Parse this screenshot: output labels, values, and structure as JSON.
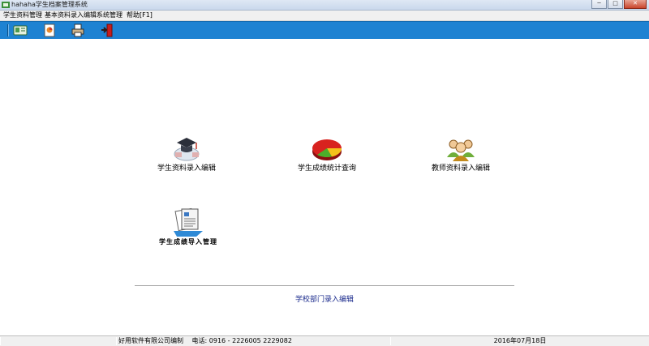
{
  "window": {
    "title": "hahaha学生档案管理系统",
    "minimize": "─",
    "maximize": "□",
    "close": "✕"
  },
  "menu": {
    "items": [
      "学生资料管理",
      "基本资料录入编辑",
      "系统管理",
      "帮助[F1]"
    ]
  },
  "toolbar": {
    "buttons": [
      "card-icon",
      "document-icon",
      "printer-icon",
      "exit-door-icon"
    ],
    "accent": "#1e82d2"
  },
  "main": {
    "features": [
      {
        "label": "学生资料录入编辑",
        "icon": "graduation-cap-icon"
      },
      {
        "label": "学生成绩统计查询",
        "icon": "pie-chart-icon"
      },
      {
        "label": "教师资料录入编辑",
        "icon": "teachers-group-icon"
      },
      {
        "label": "学生成绩导入管理",
        "icon": "report-document-icon"
      }
    ],
    "link": "学校部门录入编辑"
  },
  "statusbar": {
    "company": "好用软件有限公司编制",
    "phone": "电话: 0916 - 2226005   2229082",
    "date": "2016年07月18日"
  }
}
